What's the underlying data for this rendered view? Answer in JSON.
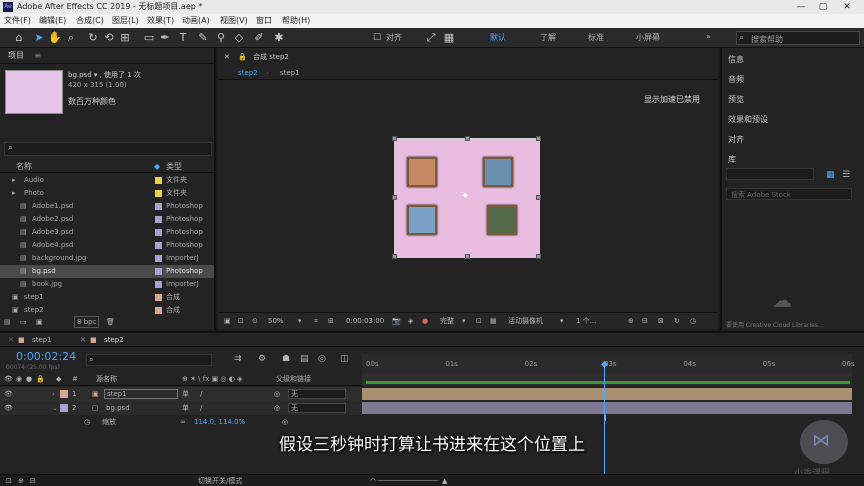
{
  "titlebar": {
    "title": "Adobe After Effects CC 2019 - 无标题项目.aep *",
    "app_icon": "Ae",
    "minimize": "—",
    "maximize": "▢",
    "close": "✕"
  },
  "menu": [
    "文件(F)",
    "编辑(E)",
    "合成(C)",
    "图层(L)",
    "效果(T)",
    "动画(A)",
    "视图(V)",
    "窗口",
    "帮助(H)"
  ],
  "toolbar": {
    "align_label": "对齐",
    "workspaces": [
      "默认",
      "了解",
      "标准",
      "小屏幕"
    ],
    "active_workspace": "默认",
    "more": "»",
    "search_placeholder": "搜索帮助"
  },
  "project": {
    "panel_title": "项目",
    "selected_name": "bg.psd ▾ , 使用了 1 次",
    "selected_dims": "420 x 315 (1.00)",
    "selected_colors": "数百万种颜色",
    "search_icon": "⌕",
    "col_name": "名称",
    "col_type": "类型",
    "bpc": "8 bpc",
    "items": [
      {
        "name": "Audio",
        "type": "文件夹",
        "color": "#e8d34a",
        "icon": "folder"
      },
      {
        "name": "Photo",
        "type": "文件夹",
        "color": "#e8d34a",
        "icon": "folder"
      },
      {
        "name": "Adobe1.psd",
        "type": "Photoshop",
        "color": "#a8a0d0",
        "icon": "file"
      },
      {
        "name": "Adobe2.psd",
        "type": "Photoshop",
        "color": "#a8a0d0",
        "icon": "file"
      },
      {
        "name": "Adobe3.psd",
        "type": "Photoshop",
        "color": "#a8a0d0",
        "icon": "file"
      },
      {
        "name": "Adobe4.psd",
        "type": "Photoshop",
        "color": "#a8a0d0",
        "icon": "file"
      },
      {
        "name": "background.jpg",
        "type": "ImporterJ",
        "color": "#a8a0d0",
        "icon": "file"
      },
      {
        "name": "bg.psd",
        "type": "Photoshop",
        "color": "#a8a0d0",
        "icon": "file"
      },
      {
        "name": "book.jpg",
        "type": "ImporterJ",
        "color": "#a8a0d0",
        "icon": "file"
      },
      {
        "name": "step1",
        "type": "合成",
        "color": "#d8a890",
        "icon": "comp"
      },
      {
        "name": "step2",
        "type": "合成",
        "color": "#d8a890",
        "icon": "comp"
      }
    ]
  },
  "viewer": {
    "panel_label": "合成 step2",
    "tabs": [
      "step2",
      "step1"
    ],
    "gpu_notice": "显示加速已禁用",
    "zoom": "50%",
    "timecode": "0:00:03:00",
    "quality": "完整",
    "camera": "活动摄像机",
    "views": "1 个..."
  },
  "right": {
    "panels": [
      "信息",
      "音频",
      "预览",
      "效果和预设",
      "对齐",
      "库"
    ],
    "stock_placeholder": "搜索 Adobe Stock",
    "cc_notice": "要使用 Creative Cloud Libraries..."
  },
  "timeline": {
    "tabs": [
      "step1",
      "step2"
    ],
    "timecode": "0:00:02:24",
    "fps": "00074 (25.00 fps)",
    "search_placeholder": "",
    "col_layer_name": "源名称",
    "col_parent": "父级和链接",
    "layers": [
      {
        "num": "1",
        "name": "step1",
        "color": "#d8a890",
        "parent": "无"
      },
      {
        "num": "2",
        "name": "bg.psd",
        "color": "#a8a0d0",
        "parent": "无"
      }
    ],
    "scale_label": "缩放",
    "scale_value": "114.0, 114.0%",
    "ruler_ticks": [
      "00s",
      "01s",
      "02s",
      "03s",
      "04s",
      "05s",
      "06s"
    ],
    "playhead_time_s": 3.0,
    "toggle_label": "切换开关/模式"
  },
  "subtitle": "假设三秒钟时打算让书进来在这个位置上",
  "watermark": "小香课程"
}
